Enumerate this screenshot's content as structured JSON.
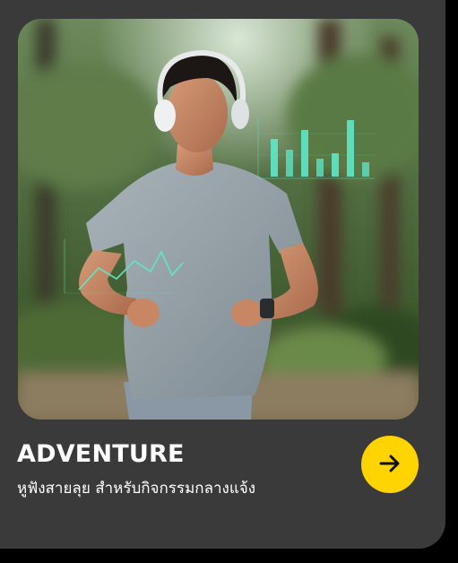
{
  "card": {
    "title": "ADVENTURE",
    "subtitle": "หูฟังสายลุย สำหรับกิจกรรมกลางแจ้ง",
    "image_subject": "Young man running outdoors in a park wearing white over-ear headphones, grey t-shirt and smartwatch, with a holographic bar chart and line graph overlay"
  },
  "action": {
    "icon": "arrow-right-icon"
  },
  "colors": {
    "page_background": "#000000",
    "card_background": "#3a3a3a",
    "button_accent": "#ffd400",
    "title_text": "#ffffff",
    "hologram": "#5fe8c8"
  }
}
